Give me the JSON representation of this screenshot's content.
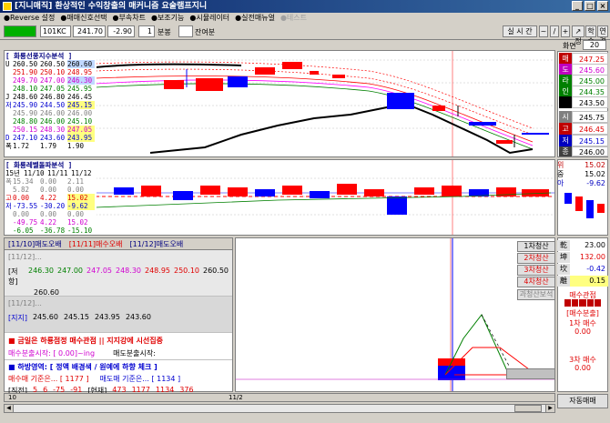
{
  "window": {
    "title": "[지니매직] 환상적인 수익창출의 매커니즘 요술램프지니"
  },
  "menu": [
    "●Reverse 설정",
    "●매매신호선택",
    "●부속차트",
    "●보조기능",
    "●시뮬레이터",
    "●실전매뉴얼",
    "●테스트"
  ],
  "toolbar": {
    "code": "101KC",
    "price": "241.70",
    "change": "-2.90",
    "interval": "1",
    "interval_unit": "분봉",
    "remain_label": "잔여분",
    "right_buttons": [
      "실 시 간",
      "~",
      "/",
      "+",
      "↗ 정",
      "학습",
      "연결"
    ],
    "screen_label": "화면",
    "screen_value": "20"
  },
  "chart1": {
    "title": "[ 화룡선풍지수분석 ]",
    "rows": [
      {
        "label": "U",
        "v": [
          "260.50",
          "260.50",
          "260.60"
        ]
      },
      {
        "label": "",
        "v": [
          "251.90",
          "250.10",
          "248.95"
        ]
      },
      {
        "label": "",
        "v": [
          "249.70",
          "247.00",
          "246.30"
        ]
      },
      {
        "label": "",
        "v": [
          "248.10",
          "247.05",
          "245.95"
        ]
      },
      {
        "label": "J",
        "v": [
          "248.60",
          "246.80",
          "246.45"
        ]
      },
      {
        "label": "저",
        "v": [
          "245.90",
          "244.50",
          "245.15"
        ]
      },
      {
        "label": "",
        "v": [
          "245.90",
          "246.00",
          "246.00"
        ]
      },
      {
        "label": "",
        "v": [
          "248.80",
          "246.00",
          "245.10"
        ]
      },
      {
        "label": "",
        "v": [
          "250.15",
          "248.30",
          "247.05"
        ]
      },
      {
        "label": "D",
        "v": [
          "247.10",
          "243.60",
          "243.95"
        ]
      },
      {
        "label": "폭",
        "v": [
          "1.72",
          "1.79",
          "1.90"
        ]
      }
    ]
  },
  "side1": [
    {
      "label": "매",
      "value": "247.25",
      "color": "#c00000"
    },
    {
      "label": "도",
      "value": "245.60",
      "color": "#c000c0"
    },
    {
      "label": "라",
      "value": "245.00",
      "color": "#008000"
    },
    {
      "label": "인",
      "value": "244.35",
      "color": "#008000"
    },
    {
      "label": "",
      "value": "243.50",
      "color": "#000000"
    }
  ],
  "side1b": [
    {
      "label": "시",
      "value": "245.75"
    },
    {
      "label": "고",
      "value": "246.45"
    },
    {
      "label": "저",
      "value": "245.15"
    },
    {
      "label": "종",
      "value": "246.00"
    }
  ],
  "chart2": {
    "title": "[ 화룡레벨돌파분석 ]",
    "header": [
      "15년",
      "11/10",
      "11/11",
      "11/12"
    ],
    "rows": [
      {
        "label": "폭",
        "v": [
          "15.34",
          "0.00",
          "2.11"
        ]
      },
      {
        "label": "",
        "v": [
          "5.82",
          "0.00",
          "0.00"
        ]
      },
      {
        "label": "고",
        "v": [
          "0.00",
          "4.22",
          "15.02"
        ]
      },
      {
        "label": "저",
        "v": [
          "-73.55",
          "-30.20",
          "-9.62"
        ]
      },
      {
        "label": "",
        "v": [
          "0.00",
          "0.00",
          "0.00"
        ]
      },
      {
        "label": "",
        "v": [
          "-49.75",
          "4.22",
          "15.02"
        ]
      },
      {
        "label": "",
        "v": [
          "-6.05",
          "-36.78",
          "-15.10"
        ]
      }
    ]
  },
  "side2": [
    {
      "label": "위",
      "value": "15.02"
    },
    {
      "label": "중",
      "value": "15.02"
    },
    {
      "label": "아",
      "value": "-9.62"
    }
  ],
  "bottom_left": {
    "tabs": [
      "[11/10]매도오배",
      "[11/11]매수오배",
      "[11/12]매도오배"
    ],
    "section1_head": "[11/12]...",
    "section1_label": "[저항]",
    "section1_vals": [
      "246.30",
      "247.00",
      "247.05",
      "248.30",
      "248.95",
      "250.10",
      "260.50"
    ],
    "section1_extra": "260.60",
    "section2_head": "[11/12]...",
    "section2_label": "[지지]",
    "section2_vals": [
      "245.60",
      "245.15",
      "243.95",
      "243.60"
    ],
    "msg_title": "■ 금일은 하룡점정 매수관점 || 지지강에 시선집중",
    "msg_buy": "매수분출시작: [ 0.00]~ing",
    "msg_sell": "매도분출시작:",
    "bottom_title": "■ 하방영역: [ 정액 배경색 / 원예에 하향 체크 ]",
    "bottom_buy": "매수매 기준은... [ 1177 ]",
    "bottom_sell": "매도매 기준은... [ 1134 ]",
    "bottom_row": [
      "[직전]",
      "5",
      "6",
      "-75",
      "-91",
      "[현재]",
      "473",
      "1177",
      "1134",
      "376"
    ]
  },
  "step_buttons": [
    "1차청산",
    "2차청산",
    "3차청산",
    "4차청산",
    "과청산보석"
  ],
  "right_panel": {
    "items": [
      {
        "label": "乾",
        "value": "23.00"
      },
      {
        "label": "坤",
        "value": "132.00"
      },
      {
        "label": "坎",
        "value": "-0.42"
      },
      {
        "label": "離",
        "value": "0.15"
      }
    ],
    "signal_title": "매수관점",
    "signal_sub": "[매수분출]",
    "signal_first": "1차 매수",
    "signal_first_val": "0.00",
    "signal_third": "3차 매수",
    "signal_third_val": "0.00",
    "auto_trade": "자동매매"
  },
  "time_axis": {
    "left": "10",
    "mid": "11/2"
  },
  "colors": {
    "up": "#ff0000",
    "down": "#0000ff",
    "bg": "#ffffff",
    "accent": "#0a246a"
  }
}
